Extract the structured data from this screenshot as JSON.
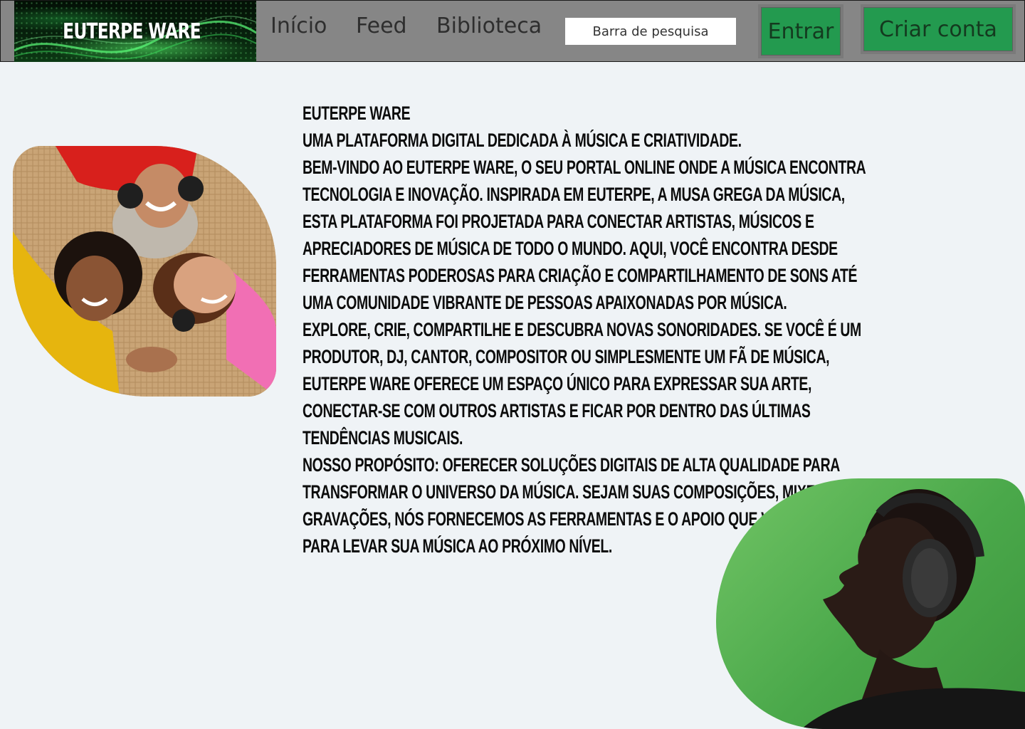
{
  "header": {
    "logo_text": "EUTERPE WARE",
    "nav": [
      {
        "label": "Início"
      },
      {
        "label": "Feed"
      },
      {
        "label": "Biblioteca"
      }
    ],
    "search": {
      "placeholder": "Barra de pesquisa",
      "value": ""
    },
    "login_label": "Entrar",
    "signup_label": "Criar conta"
  },
  "colors": {
    "header_bg": "#868686",
    "button_bg": "#239a4f",
    "page_bg": "#eff3f6",
    "logo_bg": "#07200c"
  },
  "images": {
    "left": "photo-three-women-with-headphones",
    "right": "photo-woman-with-headphones-green-background"
  },
  "main": {
    "paragraphs": [
      "Euterpe Ware",
      "Uma plataforma digital dedicada à música e criatividade.",
      "Bem-vindo ao Euterpe Ware, o seu portal online onde a música encontra tecnologia e inovação. Inspirada em Euterpe, a musa grega da música, esta plataforma foi projetada para conectar artistas, músicos e apreciadores de música de todo o mundo. Aqui, você encontra desde ferramentas poderosas para criação e compartilhamento de sons até uma comunidade vibrante de pessoas apaixonadas por música.",
      "Explore, crie, compartilhe e descubra novas sonoridades. Se você é um produtor, DJ, cantor, compositor ou simplesmente um fã de música, Euterpe Ware oferece um espaço único para expressar sua arte, conectar-se com outros artistas e ficar por dentro das últimas tendências musicais.",
      "Nosso propósito: oferecer soluções digitais de alta qualidade para transformar o universo da música. Sejam suas composições, mixes ou gravações, nós fornecemos as ferramentas e o apoio que você precisa para levar sua música ao próximo nível."
    ]
  }
}
